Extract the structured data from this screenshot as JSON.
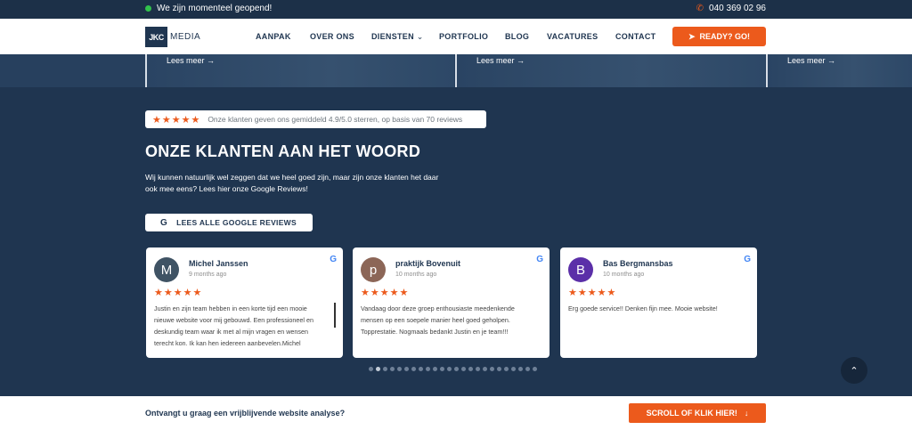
{
  "topbar": {
    "status": "We zijn momenteel geopend!",
    "phone": "040 369 02 96"
  },
  "nav": {
    "logo_mark": "JKC",
    "logo_text": "MEDIA",
    "items": [
      "AANPAK",
      "OVER ONS",
      "DIENSTEN",
      "PORTFOLIO",
      "BLOG",
      "VACATURES",
      "CONTACT"
    ],
    "cta": "READY? GO!"
  },
  "strip": {
    "cards": [
      {
        "link": "Lees meer"
      },
      {
        "link": "Lees meer"
      },
      {
        "link": "Lees meer"
      }
    ]
  },
  "section": {
    "badge": "Onze klanten geven ons gemiddeld 4.9/5.0 sterren, op basis van 70 reviews",
    "heading": "ONZE KLANTEN AAN HET WOORD",
    "intro": "Wij kunnen natuurlijk wel zeggen dat we heel goed zijn, maar zijn onze klanten het daar ook mee eens? Lees hier onze Google Reviews!",
    "reviews_button": "LEES ALLE GOOGLE REVIEWS"
  },
  "reviews": [
    {
      "initial": "M",
      "name": "Michel Janssen",
      "time": "9 months ago",
      "stars": "★★★★★",
      "text": "Justin en zijn team hebben in een korte tijd een mooie nieuwe website voor mij gebouwd. Een professioneel en deskundig team waar ik met al mijn vragen en wensen terecht kon. Ik kan hen iedereen aanbevelen.Michel",
      "color": "#3f5364"
    },
    {
      "initial": "p",
      "name": "praktijk Bovenuit",
      "time": "10 months ago",
      "stars": "★★★★★",
      "text": "Vandaag door deze groep enthousiaste meedenkende mensen op een soepele manier heel goed geholpen. Topprestatie. Nogmaals bedankt Justin en je team!!!",
      "color": "#8c6657"
    },
    {
      "initial": "B",
      "name": "Bas Bergmansbas",
      "time": "10 months ago",
      "stars": "★★★★★",
      "text": "Erg goede service!! Denken fijn mee. Mooie website!",
      "color": "#5b2fa8"
    }
  ],
  "carousel": {
    "dot_count": 24,
    "active_index": 1
  },
  "bottombar": {
    "label": "Ontvangt u graag een vrijblijvende website analyse?",
    "button": "SCROLL OF KLIK HIER!"
  },
  "colors": {
    "navy": "#1f3550",
    "accent": "#ec5a1c",
    "open": "#31c24c"
  }
}
